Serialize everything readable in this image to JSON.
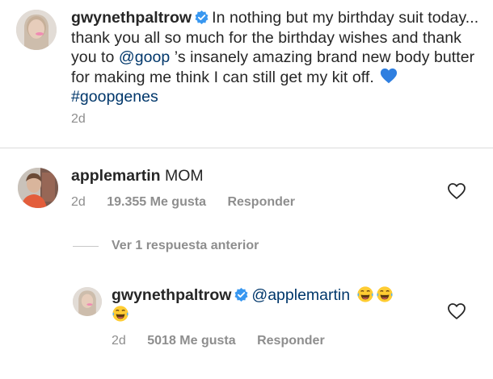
{
  "caption": {
    "username": "gwynethpaltrow",
    "text_part1": "In nothing but my birthday suit today... thank you all so much for the birthday wishes and thank you to ",
    "mention": "@goop",
    "text_part2": " ’s insanely amazing brand new body butter for making me think I can still get my kit off. ",
    "hashtag": "#goopgenes",
    "time": "2d",
    "verified_icon": "verified-badge-icon",
    "emoji_icon": "blue-heart-icon"
  },
  "comments": [
    {
      "username": "applemartin",
      "text": "MOM",
      "time": "2d",
      "likes": "19.355 Me gusta",
      "reply_label": "Responder",
      "like_icon": "heart-outline-icon"
    }
  ],
  "view_replies": {
    "label": "Ver 1 respuesta anterior"
  },
  "replies": [
    {
      "username": "gwynethpaltrow",
      "mention": "@applemartin",
      "emoji_icon": "laughing-tears-icon",
      "emoji_count": 3,
      "time": "2d",
      "likes": "5018 Me gusta",
      "reply_label": "Responder",
      "verified_icon": "verified-badge-icon",
      "like_icon": "heart-outline-icon"
    }
  ],
  "colors": {
    "text": "#262626",
    "secondary": "#8e8e8e",
    "link": "#00376b",
    "verified": "#3897f0",
    "blue_heart": "#2f7fe0",
    "divider": "#dbdbdb"
  }
}
